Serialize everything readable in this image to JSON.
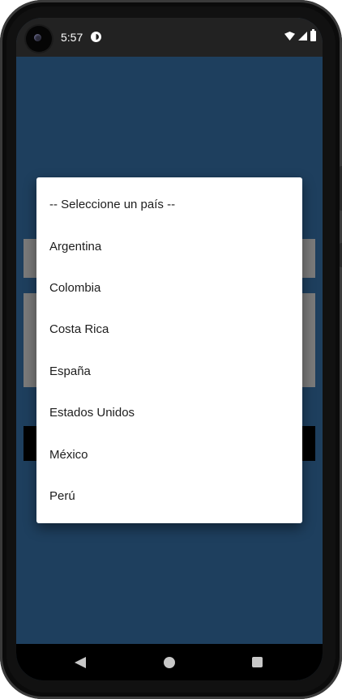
{
  "status_bar": {
    "time": "5:57",
    "icons": [
      "camera-cutout",
      "app-notification-icon",
      "wifi-icon",
      "signal-icon",
      "battery-icon"
    ]
  },
  "dialog": {
    "options": [
      "-- Seleccione un país --",
      "Argentina",
      "Colombia",
      "Costa Rica",
      "España",
      "Estados Unidos",
      "México",
      "Perú"
    ]
  },
  "nav_bar": {
    "icons": [
      "back-icon",
      "home-icon",
      "recents-icon"
    ]
  },
  "colors": {
    "app_background": "#1e3f5e",
    "status_bar": "#222222",
    "dialog_background": "#ffffff",
    "dimmed_field": "#7a7a7a",
    "nav_bar": "#000000"
  }
}
